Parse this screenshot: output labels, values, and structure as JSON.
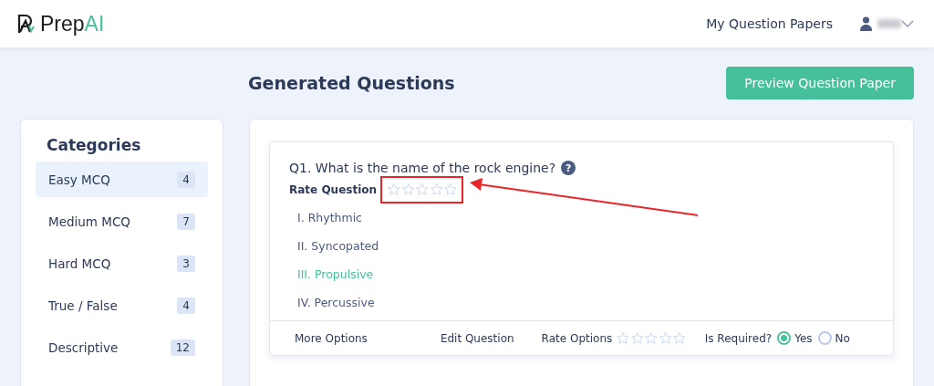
{
  "header": {
    "logo_prefix": "Prep",
    "logo_suffix": "AI",
    "nav_link": "My Question Papers"
  },
  "page_title": "Generated Questions",
  "preview_button": "Preview Question Paper",
  "sidebar": {
    "title": "Categories",
    "items": [
      {
        "label": "Easy MCQ",
        "count": "4",
        "selected": true
      },
      {
        "label": "Medium MCQ",
        "count": "7",
        "selected": false
      },
      {
        "label": "Hard MCQ",
        "count": "3",
        "selected": false
      },
      {
        "label": "True / False",
        "count": "4",
        "selected": false
      },
      {
        "label": "Descriptive",
        "count": "12",
        "selected": false
      }
    ]
  },
  "question": {
    "text": "Q1. What is the name of the rock engine?",
    "help": "?",
    "rate_label": "Rate Question",
    "stars": 0,
    "options": [
      {
        "text": "I. Rhythmic",
        "correct": false
      },
      {
        "text": "II. Syncopated",
        "correct": false
      },
      {
        "text": "III. Propulsive",
        "correct": true
      },
      {
        "text": "IV. Percussive",
        "correct": false
      }
    ],
    "footer": {
      "more": "More Options",
      "edit": "Edit Question",
      "rate_options_label": "Rate Options",
      "rate_options": {
        "stars": 0
      },
      "required_label": "Is Required?",
      "choices": [
        {
          "label": "Yes",
          "selected": true
        },
        {
          "label": "No",
          "selected": false
        }
      ]
    }
  }
}
